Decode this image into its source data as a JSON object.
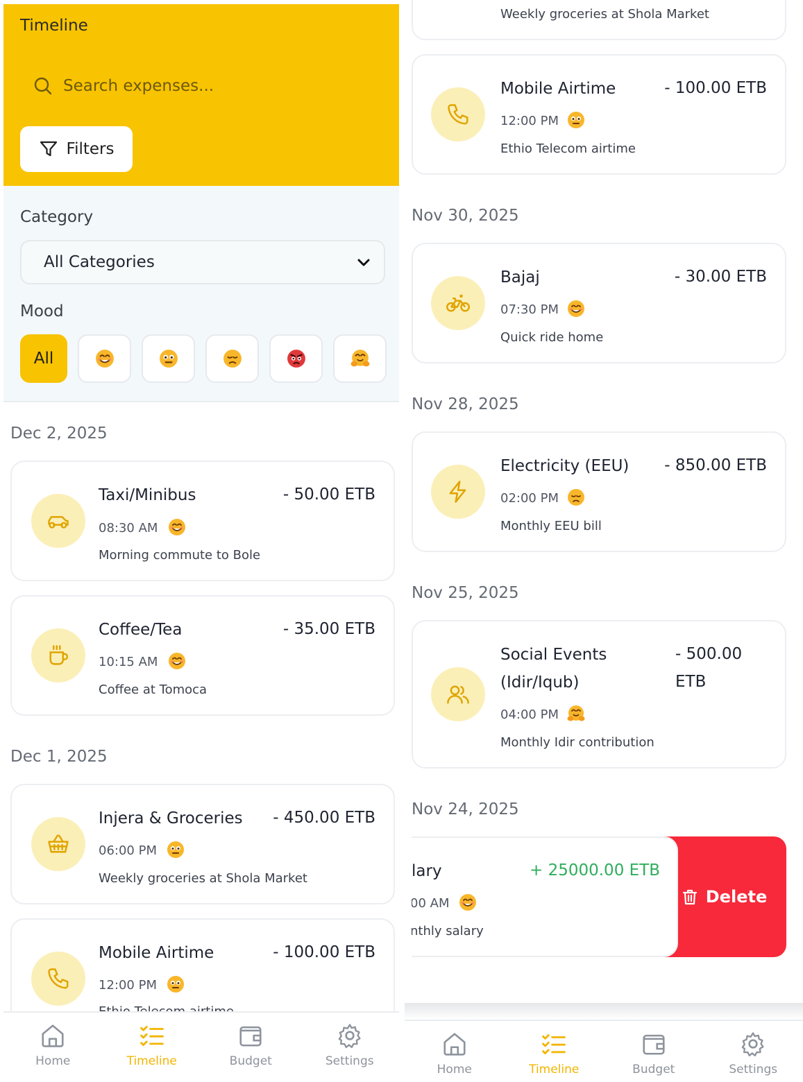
{
  "header": {
    "title": "Timeline",
    "search_placeholder": "Search expenses...",
    "filters_label": "Filters"
  },
  "filters": {
    "category_label": "Category",
    "category_value": "All Categories",
    "mood_label": "Mood",
    "mood_all": "All",
    "moods": [
      "happy",
      "neutral",
      "sad",
      "angry",
      "hug"
    ]
  },
  "left": {
    "dates": [
      "Dec 2, 2025",
      "Dec 1, 2025"
    ],
    "items": [
      {
        "title": "Taxi/Minibus",
        "amount": "- 50.00 ETB",
        "time": "08:30 AM",
        "memo": "Morning commute to Bole",
        "icon": "car-icon",
        "mood": "happy"
      },
      {
        "title": "Coffee/Tea",
        "amount": "- 35.00 ETB",
        "time": "10:15 AM",
        "memo": "Coffee at Tomoca",
        "icon": "coffee-icon",
        "mood": "happy"
      },
      {
        "title": "Injera & Groceries",
        "amount": "- 450.00 ETB",
        "time": "06:00 PM",
        "memo": "Weekly groceries at Shola Market",
        "icon": "basket-icon",
        "mood": "neutral"
      },
      {
        "title": "Mobile Airtime",
        "amount": "- 100.00 ETB",
        "time": "12:00 PM",
        "memo": "Ethio Telecom airtime",
        "icon": "phone-icon",
        "mood": "neutral"
      }
    ]
  },
  "right": {
    "top_partial_memo": "Weekly groceries at Shola Market",
    "dates": [
      "Nov 30, 2025",
      "Nov 28, 2025",
      "Nov 25, 2025",
      "Nov 24, 2025"
    ],
    "items": [
      {
        "title": "Mobile Airtime",
        "amount": "- 100.00 ETB",
        "time": "12:00 PM",
        "memo": "Ethio Telecom airtime",
        "icon": "phone-icon",
        "mood": "neutral"
      },
      {
        "title": "Bajaj",
        "amount": "- 30.00 ETB",
        "time": "07:30 PM",
        "memo": "Quick ride home",
        "icon": "bike-icon",
        "mood": "happy"
      },
      {
        "title": "Electricity (EEU)",
        "amount": "- 850.00 ETB",
        "time": "02:00 PM",
        "memo": "Monthly EEU bill",
        "icon": "lightning-icon",
        "mood": "sad"
      },
      {
        "title_line1": "Social Events",
        "title_line2": "(Idir/Iqub)",
        "amount_line1": "- 500.00",
        "amount_line2": "ETB",
        "time": "04:00 PM",
        "memo": "Monthly Idir contribution",
        "icon": "users-icon",
        "mood": "hug"
      }
    ],
    "swiped": {
      "title": "lary",
      "amount": "+ 25000.00 ETB",
      "time": "00 AM",
      "memo": "nthly salary",
      "delete_label": "Delete"
    }
  },
  "nav": {
    "home": "Home",
    "timeline": "Timeline",
    "budget": "Budget",
    "settings": "Settings"
  },
  "colors": {
    "accent": "#f8c300",
    "danger": "#f7293a",
    "income": "#2fae5c"
  }
}
